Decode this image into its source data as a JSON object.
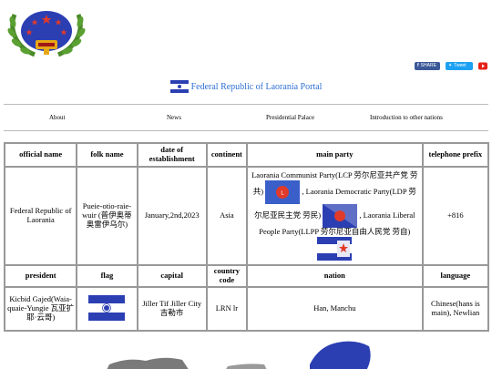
{
  "header": {
    "portal_title": "Federal Republic of Laorania Portal"
  },
  "social": {
    "facebook_label": "SHARE",
    "twitter_label": "Tweet"
  },
  "nav": {
    "items": [
      "About",
      "News",
      "Presidential Palace",
      "Introduction to other nations"
    ]
  },
  "table": {
    "row1_headers": {
      "official_name": "official name",
      "folk_name": "folk name",
      "date": "date of establishment",
      "continent": "continent",
      "main_party": "main party",
      "telephone": "telephone prefix"
    },
    "row2": {
      "official_name": "Federal Republic of Laorania",
      "folk_name": "Pueie-otio-raie-wuir (普伊奥蒂奥雷伊乌尔)",
      "date": "January,2nd,2023",
      "continent": "Asia",
      "party_lcp_a": "Laorania Communist Party(LCP 劳尔尼亚共产党 劳共)",
      "party_lcp_b": ", Laorania Democratic Party(LDP 劳尔尼亚民主党 劳民)",
      "party_ldp_b": ", Laorania Liberal People Party(LLPP 劳尔尼亚自由人民党 劳自)",
      "telephone": "+816"
    },
    "row3_headers": {
      "president": "president",
      "flag": "flag",
      "capital": "capital",
      "country_code": "country code",
      "nation": "nation",
      "language": "language"
    },
    "row4": {
      "president": "Kicbid Gajed(Waia-quaie-Yungie 瓦亚扩耶·云哥)",
      "capital": "Jiller Tif Jiller City 吉勒市",
      "country_code": "LRN lr",
      "nation": "Han, Manchu",
      "language": "Chinese(hans is main), Newlian"
    }
  },
  "colors": {
    "portal_link": "#2f6fd4",
    "flag_blue": "#2b3fb3",
    "facebook": "#3b5998",
    "twitter": "#1da1f2",
    "youtube": "#e62117"
  }
}
